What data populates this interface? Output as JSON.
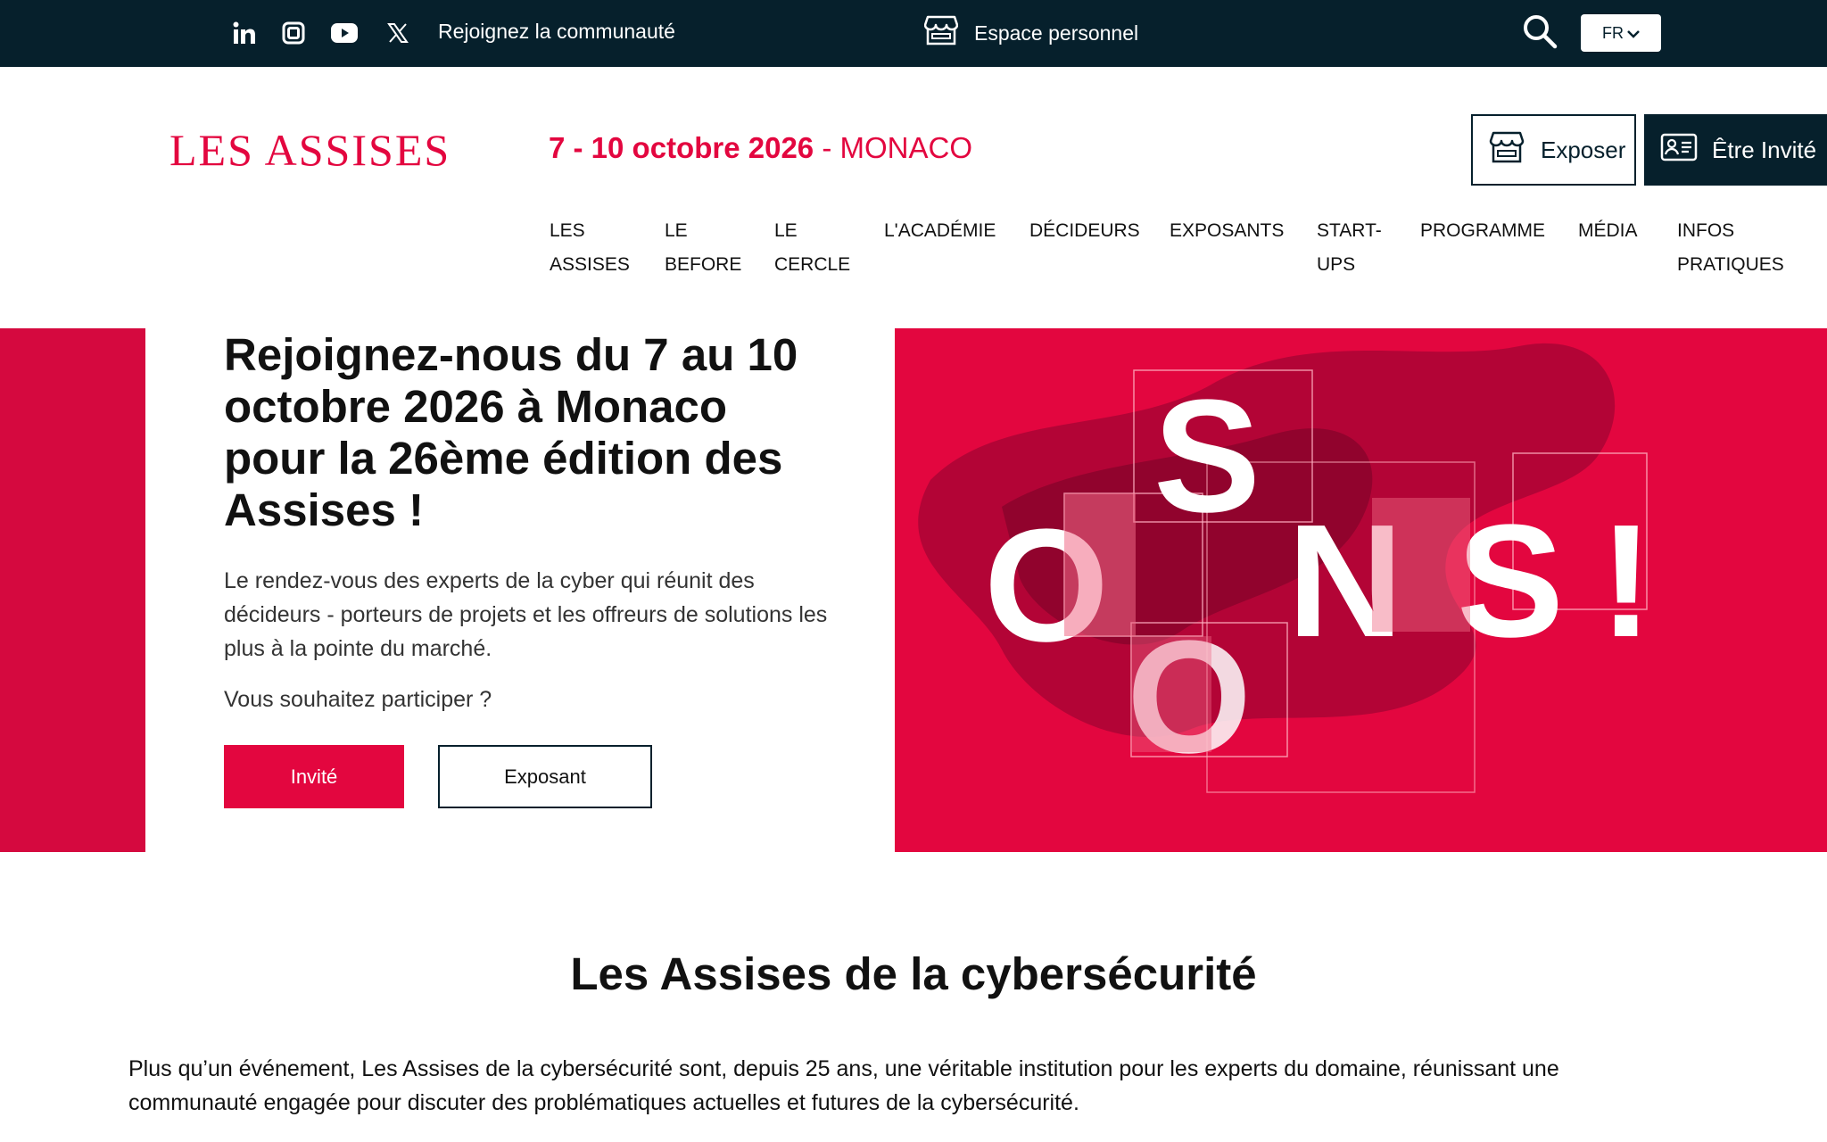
{
  "topbar": {
    "social": [
      {
        "name": "linkedin-icon",
        "label": "in"
      },
      {
        "name": "instagram-icon",
        "label": ""
      },
      {
        "name": "youtube-icon",
        "label": ""
      },
      {
        "name": "x-icon",
        "label": "X"
      }
    ],
    "community_label": "Rejoignez la communauté",
    "espace_label": "Espace personnel",
    "lang": "FR"
  },
  "header": {
    "logo": "LES ASSISES",
    "date_bold": "7 - 10 octobre 2026",
    "date_place": " - MONACO",
    "expose_label": "Exposer",
    "invite_label": "Être Invité"
  },
  "nav": [
    {
      "label": "LES\nASSISES"
    },
    {
      "label": "LE\nBEFORE"
    },
    {
      "label": "LE\nCERCLE"
    },
    {
      "label": "L'ACADÉMIE"
    },
    {
      "label": "DÉCIDEURS"
    },
    {
      "label": "EXPOSANTS"
    },
    {
      "label": "START-\nUPS"
    },
    {
      "label": "PROGRAMME"
    },
    {
      "label": "MÉDIA"
    },
    {
      "label": "INFOS\nPRATIQUES"
    }
  ],
  "hero": {
    "title": "Rejoignez-nous du 7 au 10 octobre 2026 à Monaco pour la 26ème édition des Assises !",
    "description": "Le rendez-vous des experts de la cyber qui réunit des décideurs - porteurs de projets et les offreurs de solutions les plus à la pointe du marché.",
    "question": "Vous souhaitez participer ?",
    "btn_primary": "Invité",
    "btn_secondary": "Exposant",
    "image_letters": [
      "S",
      "O",
      "O",
      "N",
      "S",
      "!"
    ]
  },
  "section": {
    "title": "Les Assises de la cybersécurité",
    "body": "Plus qu’un événement, Les Assises de la cybersécurité sont, depuis 25 ans, une véritable institution pour les experts du domaine, réunissant une communauté engagée pour discuter des problématiques actuelles et futures de la cybersécurité."
  },
  "colors": {
    "brand_red": "#e3063f",
    "navy": "#06202c",
    "accent_pink": "#f06a86"
  }
}
